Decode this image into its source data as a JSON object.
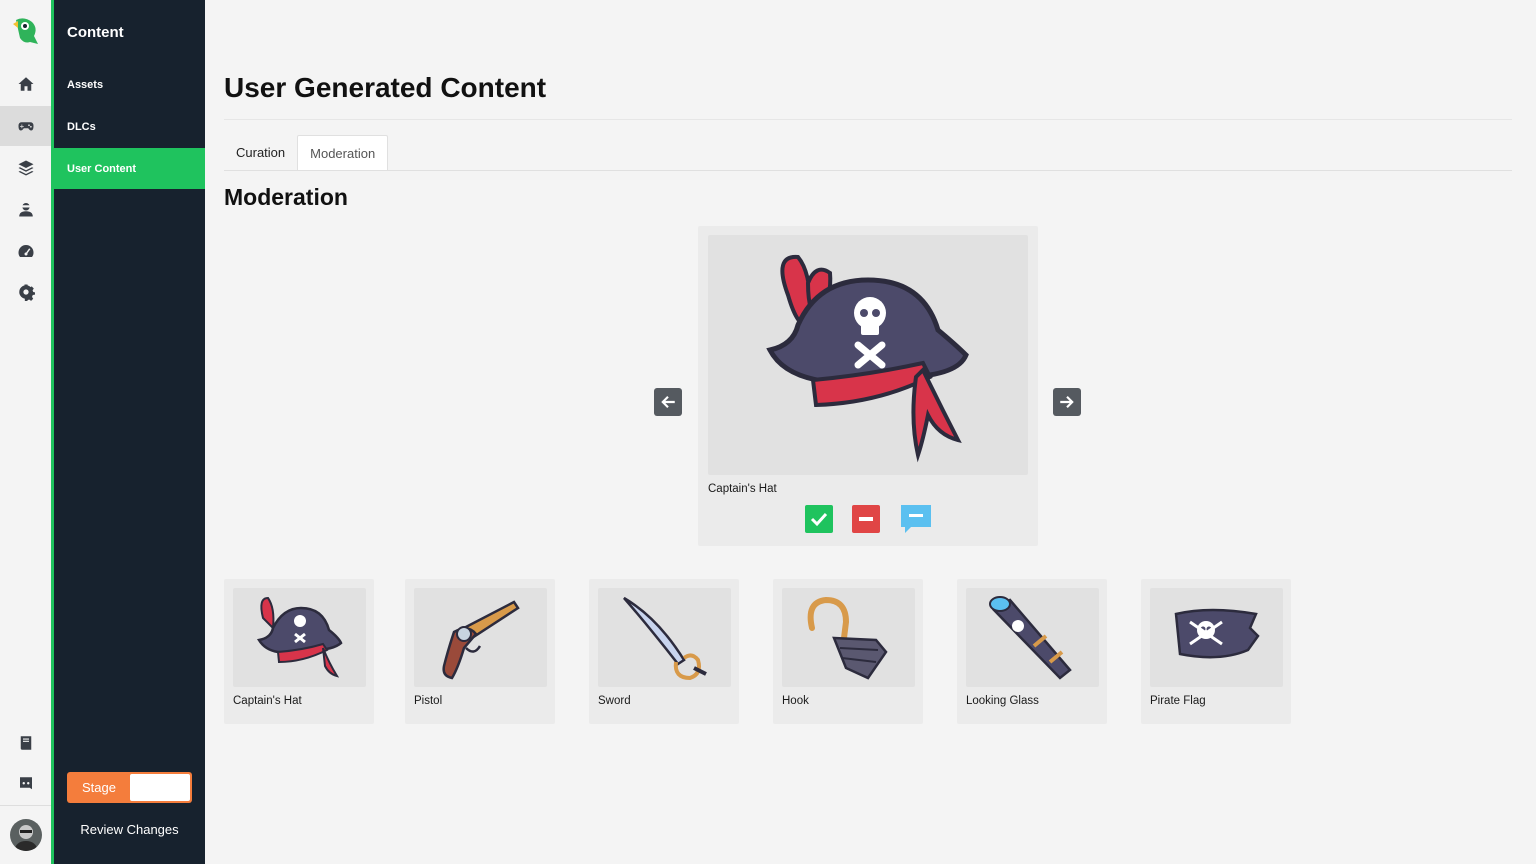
{
  "rail": {
    "items": [
      "home-icon",
      "gamepad-icon",
      "layers-icon",
      "agent-icon",
      "dashboard-icon",
      "gear-icon"
    ],
    "bottom": [
      "book-icon",
      "discord-icon"
    ]
  },
  "sidebar": {
    "title": "Content",
    "items": [
      {
        "label": "Assets"
      },
      {
        "label": "DLCs"
      },
      {
        "label": "User Content"
      }
    ],
    "stage_label": "Stage",
    "review_label": "Review Changes"
  },
  "main": {
    "title": "User Generated Content",
    "tabs": [
      {
        "label": "Curation"
      },
      {
        "label": "Moderation"
      }
    ],
    "active_tab": "Moderation",
    "section_title": "Moderation",
    "selected": {
      "name": "Captain's Hat",
      "actions": [
        "approve-icon",
        "reject-icon",
        "comment-icon"
      ]
    },
    "items": [
      {
        "name": "Captain's Hat",
        "icon": "captains-hat-icon"
      },
      {
        "name": "Pistol",
        "icon": "pistol-icon"
      },
      {
        "name": "Sword",
        "icon": "sword-icon"
      },
      {
        "name": "Hook",
        "icon": "hook-icon"
      },
      {
        "name": "Looking Glass",
        "icon": "looking-glass-icon"
      },
      {
        "name": "Pirate Flag",
        "icon": "pirate-flag-icon"
      }
    ]
  },
  "colors": {
    "accent": "#1fc35e",
    "sidebar_bg": "#17222e",
    "stage": "#f47d3c",
    "approve": "#1fc35e",
    "reject": "#e04545",
    "comment": "#5bc0f0"
  }
}
